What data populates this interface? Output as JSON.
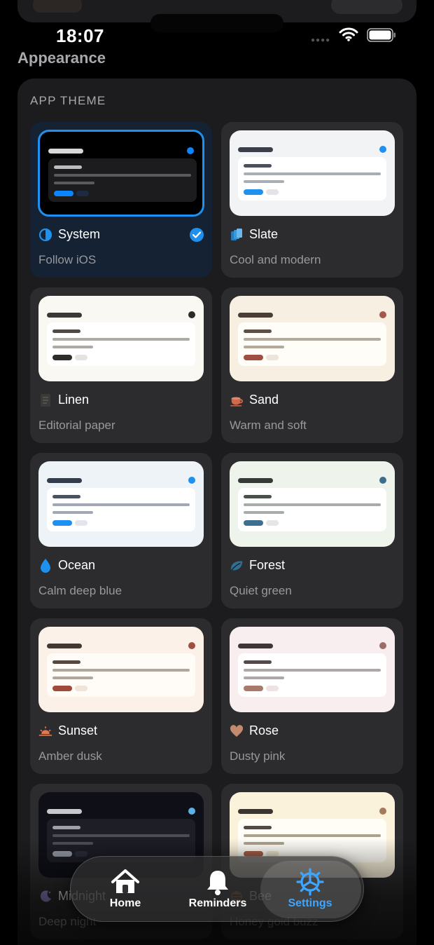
{
  "status": {
    "time": "18:07"
  },
  "page": {
    "title": "Appearance"
  },
  "section": {
    "label": "APP THEME"
  },
  "themes": [
    {
      "name": "System",
      "desc": "Follow iOS",
      "icon": "half-circle-icon",
      "selected": true,
      "colors": {
        "bg": "#000000",
        "title": "#d8d8d8",
        "dot": "#0a84ff",
        "inner": "#1c1c1e",
        "l1": "#bdbdbd",
        "line": "#5a5a5e",
        "btn": "#0a84ff",
        "btn2": "#1e2a44"
      }
    },
    {
      "name": "Slate",
      "desc": "Cool and modern",
      "icon": "layers-icon",
      "selected": false,
      "colors": {
        "bg": "#f2f3f5",
        "title": "#3a3f4a",
        "dot": "#1e90f0",
        "inner": "#ffffff",
        "l1": "#4b505a",
        "line": "#a9adb5",
        "btn": "#1e90f0",
        "btn2": "#e2e4e8"
      }
    },
    {
      "name": "Linen",
      "desc": "Editorial paper",
      "icon": "document-icon",
      "selected": false,
      "colors": {
        "bg": "#faf8f3",
        "title": "#3b3937",
        "dot": "#2c2a28",
        "inner": "#ffffff",
        "l1": "#4e4b47",
        "line": "#adaaa4",
        "btn": "#2f2d2b",
        "btn2": "#e5e3df"
      }
    },
    {
      "name": "Sand",
      "desc": "Warm and soft",
      "icon": "cup-icon",
      "selected": false,
      "colors": {
        "bg": "#f6efe2",
        "title": "#4a3d33",
        "dot": "#a3584a",
        "inner": "#fffdf8",
        "l1": "#5d5047",
        "line": "#b4aa9c",
        "btn": "#9e4f42",
        "btn2": "#ece5db"
      }
    },
    {
      "name": "Ocean",
      "desc": "Calm deep blue",
      "icon": "drop-icon",
      "selected": false,
      "colors": {
        "bg": "#eef3f8",
        "title": "#343c4c",
        "dot": "#1e90f0",
        "inner": "#ffffff",
        "l1": "#4a5262",
        "line": "#a1a8b3",
        "btn": "#1e90f0",
        "btn2": "#e2e6ec"
      }
    },
    {
      "name": "Forest",
      "desc": "Quiet green",
      "icon": "leaf-icon",
      "selected": false,
      "colors": {
        "bg": "#eef3ec",
        "title": "#343a36",
        "dot": "#3d6e8c",
        "inner": "#ffffff",
        "l1": "#4a504c",
        "line": "#a6aca8",
        "btn": "#3f6f8e",
        "btn2": "#e3e6e3"
      }
    },
    {
      "name": "Sunset",
      "desc": "Amber dusk",
      "icon": "sunset-icon",
      "selected": false,
      "colors": {
        "bg": "#fbf1e8",
        "title": "#433833",
        "dot": "#9e5040",
        "inner": "#fffcf8",
        "l1": "#55483f",
        "line": "#b0a79c",
        "btn": "#a04a3a",
        "btn2": "#f1e3d8"
      }
    },
    {
      "name": "Rose",
      "desc": "Dusty pink",
      "icon": "heart-icon",
      "selected": false,
      "colors": {
        "bg": "#f8eef0",
        "title": "#3e3537",
        "dot": "#9c6c66",
        "inner": "#ffffff",
        "l1": "#53494b",
        "line": "#afa6a8",
        "btn": "#a77a6b",
        "btn2": "#f0e2e2"
      }
    },
    {
      "name": "Midnight",
      "desc": "Deep night",
      "icon": "moon-icon",
      "selected": false,
      "colors": {
        "bg": "#0f1017",
        "title": "#c8c8cc",
        "dot": "#5ab1e6",
        "inner": "#1d1e26",
        "l1": "#a0a0a6",
        "line": "#4c4d55",
        "btn": "#8e96a0",
        "btn2": "#2a2c3a"
      }
    },
    {
      "name": "Bee",
      "desc": "Honey gold buzz",
      "icon": "bee-icon",
      "selected": false,
      "colors": {
        "bg": "#fbf2dc",
        "title": "#3b3530",
        "dot": "#a37a5a",
        "inner": "#fffdf6",
        "l1": "#514a42",
        "line": "#aca18e",
        "btn": "#a8624a",
        "btn2": "#efe6d2"
      }
    }
  ],
  "tabs": [
    {
      "label": "Home",
      "icon": "home-icon",
      "active": false
    },
    {
      "label": "Reminders",
      "icon": "bell-icon",
      "active": false
    },
    {
      "label": "Settings",
      "icon": "gear-icon",
      "active": true
    }
  ],
  "accent": "#3ea6ff"
}
